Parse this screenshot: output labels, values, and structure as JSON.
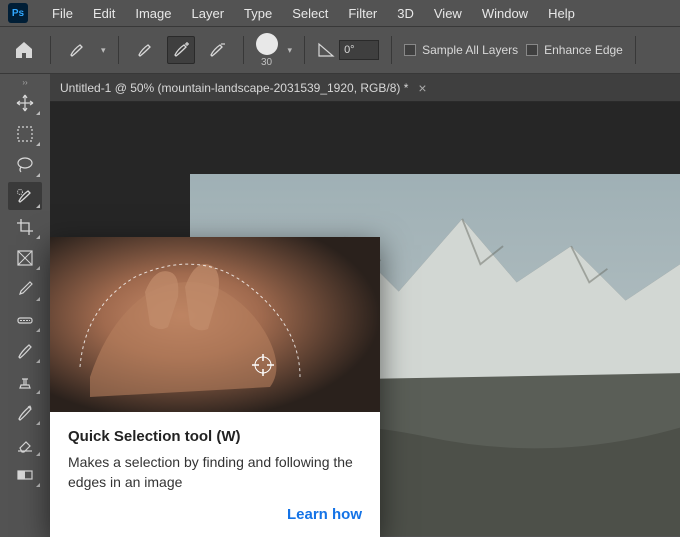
{
  "menu": {
    "items": [
      "File",
      "Edit",
      "Image",
      "Layer",
      "Type",
      "Select",
      "Filter",
      "3D",
      "View",
      "Window",
      "Help"
    ]
  },
  "options": {
    "brush_size": "30",
    "angle": "0°",
    "sample_all": "Sample All Layers",
    "enhance": "Enhance Edge"
  },
  "tab": {
    "title": "Untitled-1 @ 50% (mountain-landscape-2031539_1920, RGB/8) *"
  },
  "tooltip": {
    "title": "Quick Selection tool (W)",
    "desc": "Makes a selection by finding and following the edges in an image",
    "learn": "Learn how"
  }
}
